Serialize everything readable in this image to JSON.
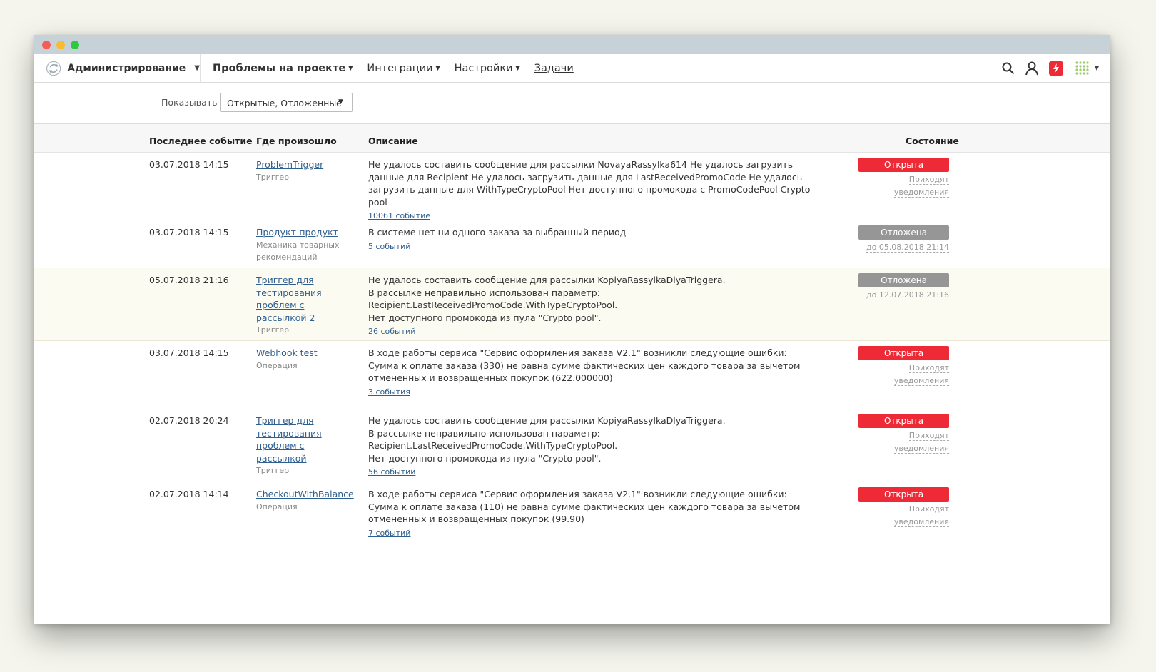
{
  "nav": {
    "admin_label": "Администрирование",
    "menu": [
      {
        "label": "Проблемы на проекте",
        "dropdown": true,
        "active": true
      },
      {
        "label": "Интеграции",
        "dropdown": true
      },
      {
        "label": "Настройки",
        "dropdown": true
      },
      {
        "label": "Задачи",
        "dropdown": false
      }
    ],
    "icons": [
      "search-icon",
      "user-icon",
      "lightning-icon",
      "apps-grid-icon"
    ]
  },
  "filter": {
    "label": "Показывать",
    "value": "Открытые, Отложенные"
  },
  "table": {
    "headers": {
      "last_event": "Последнее событие",
      "where": "Где произошло",
      "description": "Описание",
      "state": "Состояние"
    },
    "rows": [
      {
        "date": "03.07.2018 14:15",
        "where": "ProblemTrigger",
        "where_type": "Триггер",
        "description": "Не удалось составить сообщение для рассылки NovayaRassylka614 Не удалось загрузить данные для Recipient Не удалось загрузить данные для LastReceivedPromoCode Не удалось загрузить данные для WithTypeCryptoPool Нет доступного промокода с PromoCodePool Crypto pool",
        "events": "10061 событие",
        "state": "Открыта",
        "state_note": "Приходят уведомления"
      },
      {
        "date": "03.07.2018 14:15",
        "where": "Продукт-продукт",
        "where_type": "Механика товарных рекомендаций",
        "description": "В системе нет ни одного заказа за выбранный период",
        "events": "5 событий",
        "state": "Отложена",
        "state_note": "до 05.08.2018 21:14"
      },
      {
        "date": "05.07.2018 21:16",
        "where": "Триггер для тестирования проблем с рассылкой 2",
        "where_type": "Триггер",
        "description_lines": [
          "Не удалось составить сообщение для рассылки KopiyaRassylkaDlyaTriggera.",
          "В рассылке неправильно использован параметр: Recipient.LastReceivedPromoCode.WithTypeCryptoPool.",
          "Нет доступного промокода из пула \"Crypto pool\"."
        ],
        "events": "26 событий",
        "state": "Отложена",
        "state_note": "до 12.07.2018 21:16"
      },
      {
        "date": "03.07.2018 14:15",
        "where": "Webhook test",
        "where_type": "Операция",
        "description": "В ходе работы сервиса \"Сервис оформления заказа V2.1\" возникли следующие ошибки: Сумма к оплате заказа (330) не равна сумме фактических цен каждого товара за вычетом отмененных и возвращенных покупок (622.000000)",
        "events": "3 события",
        "state": "Открыта",
        "state_note": "Приходят уведомления"
      },
      {
        "date": "02.07.2018 20:24",
        "where": "Триггер для тестирования проблем с рассылкой",
        "where_type": "Триггер",
        "description_lines": [
          "Не удалось составить сообщение для рассылки KopiyaRassylkaDlyaTriggera.",
          "В рассылке неправильно использован параметр: Recipient.LastReceivedPromoCode.WithTypeCryptoPool.",
          "Нет доступного промокода из пула \"Crypto pool\"."
        ],
        "events": "56 событий",
        "state": "Открыта",
        "state_note": "Приходят уведомления"
      },
      {
        "date": "02.07.2018 14:14",
        "where": "CheckoutWithBalance",
        "where_type": "Операция",
        "description": "В ходе работы сервиса \"Сервис оформления заказа V2.1\" возникли следующие ошибки: Сумма к оплате заказа (110) не равна сумме фактических цен каждого товара за вычетом отмененных и возвращенных покупок (99.90)",
        "events": "7 событий",
        "state": "Открыта",
        "state_note": "Приходят уведомления"
      }
    ]
  },
  "colors": {
    "open": "#ee2a36",
    "postponed": "#969696",
    "titlebar": "#c6d1d8",
    "highlight_row": "#fcfbf1"
  }
}
